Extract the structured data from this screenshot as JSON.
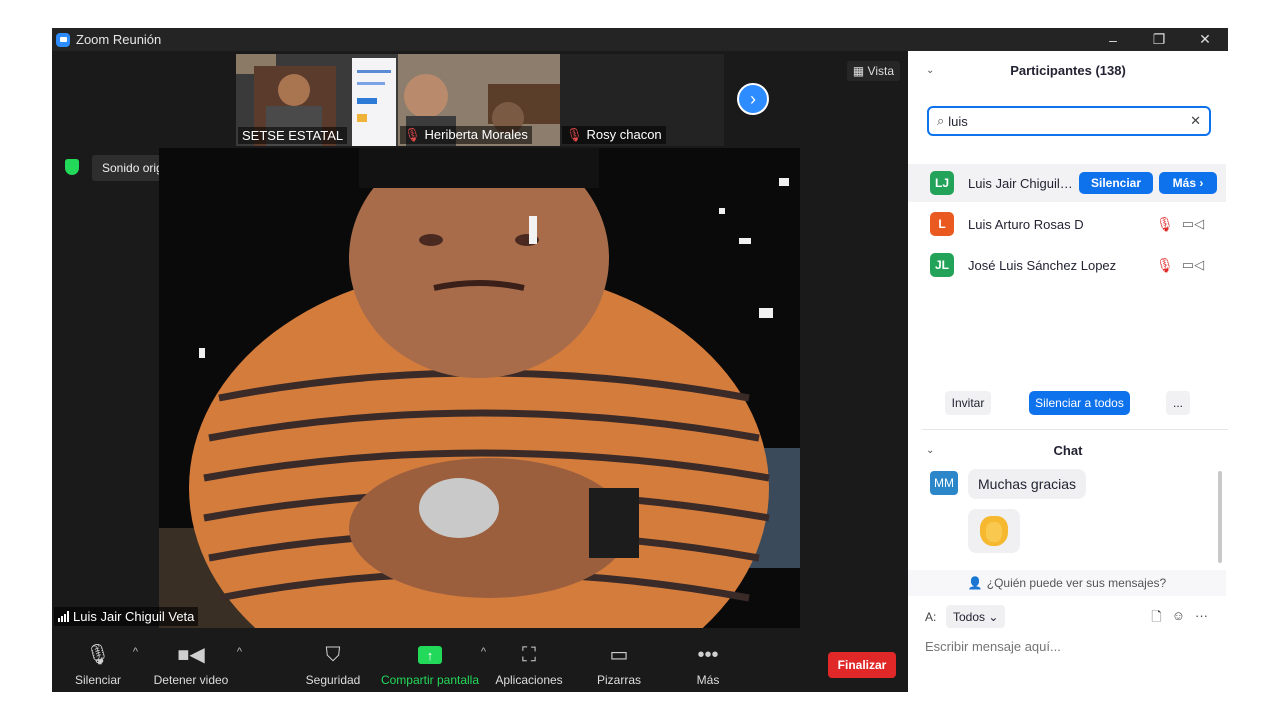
{
  "window": {
    "title": "Zoom Reunión",
    "controls": [
      "–",
      "❐",
      "✕"
    ]
  },
  "gallery": {
    "tiles": [
      {
        "name": "SETSE ESTATAL",
        "muted": false
      },
      {
        "name": "Heriberta Morales",
        "muted": true
      },
      {
        "name": "Rosy chacon",
        "muted": true
      }
    ],
    "next": "›",
    "view_label": "Vista"
  },
  "original_sound": {
    "label": "Sonido original: desactivado",
    "caret": "▾"
  },
  "speaker": {
    "name": "Luis Jair Chiguil Veta"
  },
  "toolbar": {
    "mute": "Silenciar",
    "video": "Detener video",
    "security": "Seguridad",
    "share": "Compartir pantalla",
    "apps": "Aplicaciones",
    "whiteboards": "Pizarras",
    "more": "Más",
    "end": "Finalizar",
    "caret": "^",
    "more_icon": "•••",
    "share_icon": "↑"
  },
  "participants": {
    "title": "Participantes (138)",
    "chevron": "⌄",
    "search_value": "luis",
    "search_icon": "⌕",
    "clear_icon": "✕",
    "list": [
      {
        "initials": "LJ",
        "name": "Luis Jair Chiguil Veta",
        "color": "#23a35a"
      },
      {
        "initials": "L",
        "name": "Luis Arturo Rosas D",
        "color": "#ea5a20"
      },
      {
        "initials": "JL",
        "name": "José Luis Sánchez Lopez",
        "color": "#23a35a"
      }
    ],
    "mute_btn": "Silenciar",
    "more_btn": "Más ›",
    "invite": "Invitar",
    "mute_all": "Silenciar a todos",
    "ellipsis": "..."
  },
  "chat": {
    "title": "Chat",
    "chevron": "⌄",
    "messages": [
      {
        "initials": "MM",
        "text": "Muchas gracias"
      }
    ],
    "who_sees": "¿Quién puede ver sus mensajes?",
    "to_label": "A:",
    "to_value": "Todos ⌄",
    "placeholder": "Escribir mensaje aquí...",
    "tools": [
      "🗋",
      "☺",
      "···"
    ]
  },
  "colors": {
    "accent": "#0e72ed",
    "end": "#e02828",
    "share": "#23d959"
  }
}
